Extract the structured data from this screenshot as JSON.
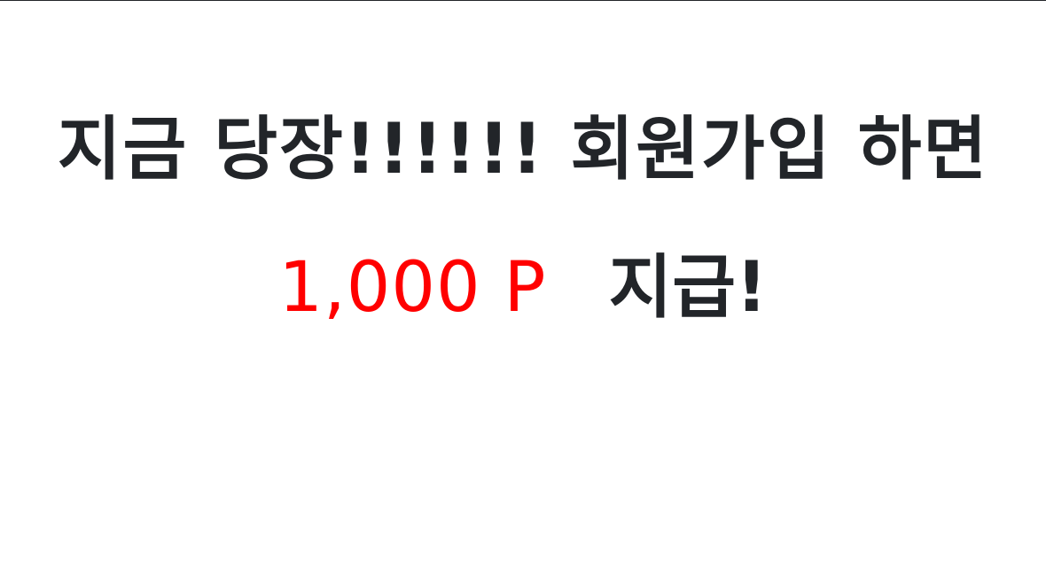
{
  "promo": {
    "headline": "지금 당장!!!!!! 회원가입 하면",
    "points": "1,000 P",
    "reward": "지급!"
  },
  "colors": {
    "text": "#222529",
    "accent": "#ff0000",
    "background": "#ffffff"
  }
}
